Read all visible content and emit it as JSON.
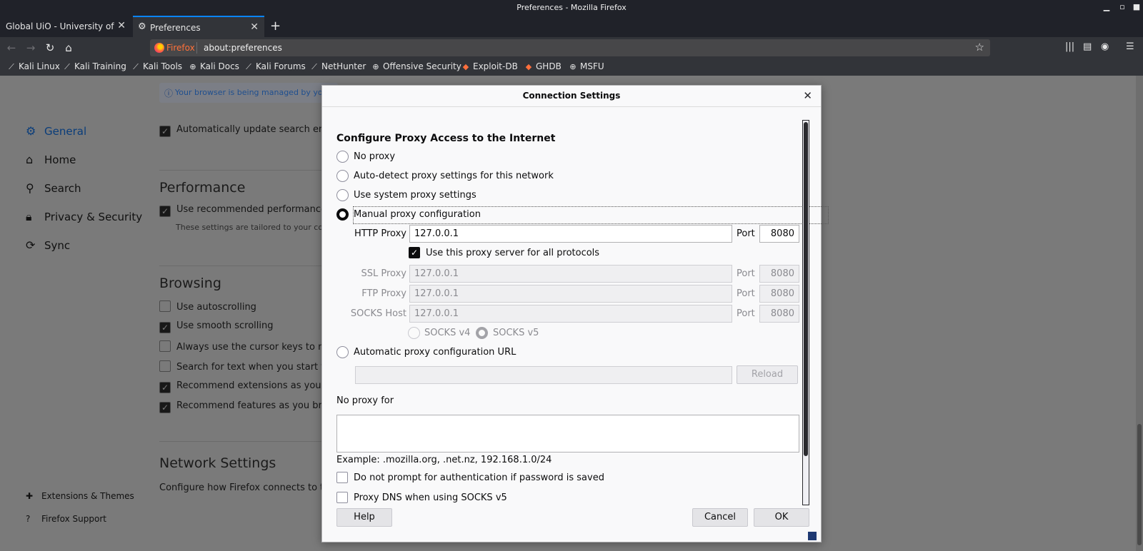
{
  "window": {
    "title": "Preferences - Mozilla Firefox"
  },
  "tabs": [
    {
      "label": "Global UiO - University of Oslo"
    },
    {
      "label": "Preferences"
    }
  ],
  "urlbar": {
    "identity": "Firefox",
    "url": "about:preferences"
  },
  "bookmarks": [
    {
      "label": "Kali Linux",
      "icon": "kali-dragon-icon"
    },
    {
      "label": "Kali Training",
      "icon": "kali-dragon-icon"
    },
    {
      "label": "Kali Tools",
      "icon": "kali-dragon-icon"
    },
    {
      "label": "Kali Docs",
      "icon": "globe-icon"
    },
    {
      "label": "Kali Forums",
      "icon": "kali-dragon-icon"
    },
    {
      "label": "NetHunter",
      "icon": "kali-dragon-icon"
    },
    {
      "label": "Offensive Security",
      "icon": "globe-icon"
    },
    {
      "label": "Exploit-DB",
      "icon": "exploit-db-icon"
    },
    {
      "label": "GHDB",
      "icon": "exploit-db-icon"
    },
    {
      "label": "MSFU",
      "icon": "globe-icon"
    }
  ],
  "prefs": {
    "notice": "Your browser is being managed by your organization.",
    "sidebar": [
      {
        "label": "General",
        "icon": "gear-icon",
        "active": true
      },
      {
        "label": "Home",
        "icon": "home-icon"
      },
      {
        "label": "Search",
        "icon": "search-icon"
      },
      {
        "label": "Privacy & Security",
        "icon": "lock-icon"
      },
      {
        "label": "Sync",
        "icon": "sync-icon"
      }
    ],
    "footer_links": [
      {
        "label": "Extensions & Themes",
        "icon": "puzzle-icon"
      },
      {
        "label": "Firefox Support",
        "icon": "help-icon"
      }
    ],
    "auto_update_search": "Automatically update search engines",
    "performance": {
      "title": "Performance",
      "recommended": "Use recommended performance settings",
      "sub": "These settings are tailored to your computer's hardware and operating system."
    },
    "browsing": {
      "title": "Browsing",
      "items": [
        {
          "label": "Use autoscrolling",
          "checked": false
        },
        {
          "label": "Use smooth scrolling",
          "checked": true
        },
        {
          "label": "Always use the cursor keys to navigate within pages",
          "checked": false
        },
        {
          "label": "Search for text when you start typing",
          "checked": false
        },
        {
          "label": "Recommend extensions as you browse",
          "checked": true
        },
        {
          "label": "Recommend features as you browse",
          "checked": true
        }
      ]
    },
    "network": {
      "title": "Network Settings",
      "desc": "Configure how Firefox connects to the internet."
    }
  },
  "dialog": {
    "title": "Connection Settings",
    "heading": "Configure Proxy Access to the Internet",
    "options": {
      "no_proxy": "No proxy",
      "auto_detect": "Auto-detect proxy settings for this network",
      "system": "Use system proxy settings",
      "manual": "Manual proxy configuration",
      "auto_url": "Automatic proxy configuration URL"
    },
    "selected": "manual",
    "http": {
      "label": "HTTP Proxy",
      "value": "127.0.0.1",
      "port_label": "Port",
      "port": "8080"
    },
    "share_all": {
      "label": "Use this proxy server for all protocols",
      "checked": true
    },
    "ssl": {
      "label": "SSL Proxy",
      "value": "127.0.0.1",
      "port_label": "Port",
      "port": "8080"
    },
    "ftp": {
      "label": "FTP Proxy",
      "value": "127.0.0.1",
      "port_label": "Port",
      "port": "8080"
    },
    "socks": {
      "label": "SOCKS Host",
      "value": "127.0.0.1",
      "port_label": "Port",
      "port": "8080"
    },
    "socks_v4": "SOCKS v4",
    "socks_v5": "SOCKS v5",
    "auto_url_value": "",
    "reload": "Reload",
    "no_proxy_for": {
      "label": "No proxy for",
      "value": ""
    },
    "example": "Example: .mozilla.org, .net.nz, 192.168.1.0/24",
    "no_auth_prompt": "Do not prompt for authentication if password is saved",
    "proxy_dns": "Proxy DNS when using SOCKS v5",
    "buttons": {
      "help": "Help",
      "cancel": "Cancel",
      "ok": "OK"
    }
  }
}
